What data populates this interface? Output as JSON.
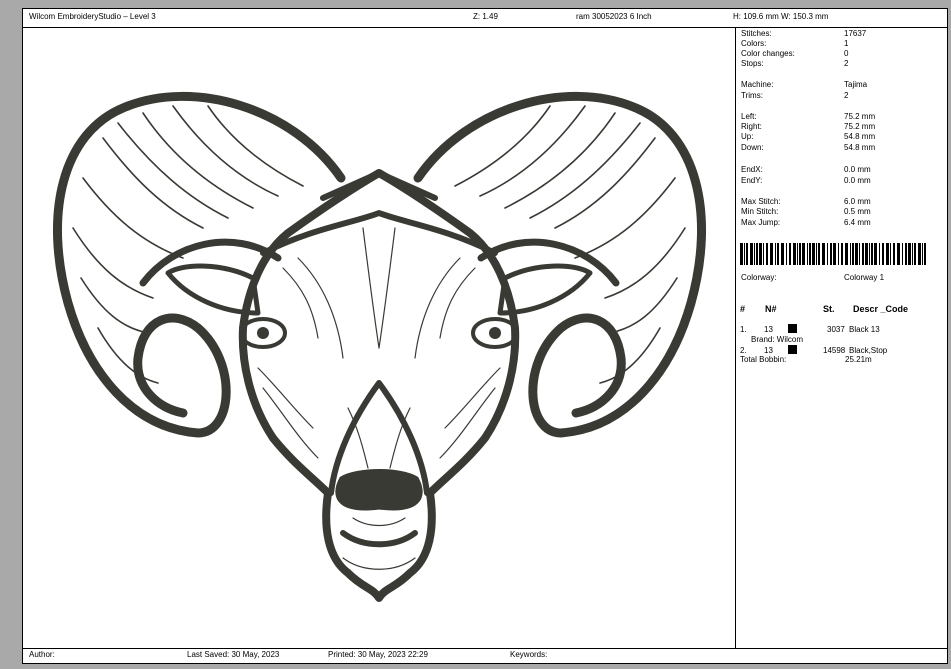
{
  "header": {
    "app": "Wilcom EmbroideryStudio – Level 3",
    "zoom": "Z: 1.49",
    "file": "ram 30052023 6  Inch",
    "size": "H: 109.6 mm   W: 150.3 mm"
  },
  "footer": {
    "author": "Author:",
    "saved": "Last Saved: 30 May, 2023",
    "printed": "Printed: 30 May, 2023 22:29",
    "keywords": "Keywords:"
  },
  "info": {
    "stats": [
      {
        "label": "Stitches:",
        "value": "17637"
      },
      {
        "label": "Colors:",
        "value": "1"
      },
      {
        "label": "Color changes:",
        "value": "0"
      },
      {
        "label": "Stops:",
        "value": "2"
      }
    ],
    "machine": [
      {
        "label": "Machine:",
        "value": "Tajima"
      },
      {
        "label": "Trims:",
        "value": "2"
      }
    ],
    "extents": [
      {
        "label": "Left:",
        "value": "75.2 mm"
      },
      {
        "label": "Right:",
        "value": "75.2 mm"
      },
      {
        "label": "Up:",
        "value": "54.8 mm"
      },
      {
        "label": "Down:",
        "value": "54.8 mm"
      }
    ],
    "end": [
      {
        "label": "EndX:",
        "value": "0.0 mm"
      },
      {
        "label": "EndY:",
        "value": "0.0 mm"
      }
    ],
    "stitch": [
      {
        "label": "Max Stitch:",
        "value": "6.0 mm"
      },
      {
        "label": "Min Stitch:",
        "value": "0.5 mm"
      },
      {
        "label": "Max Jump:",
        "value": "6.4 mm"
      }
    ],
    "colorway_label": "Colorway:",
    "colorway_value": "Colorway 1"
  },
  "table": {
    "headers": [
      "#",
      "N#",
      "St.",
      "Descr _Code"
    ],
    "rows": [
      {
        "idx": "1.",
        "n": "13",
        "st": "3037",
        "descr": "Black 13",
        "brand": "Brand: Wilcom"
      },
      {
        "idx": "2.",
        "n": "13",
        "st": "14598",
        "descr": "Black,Stop",
        "brand": ""
      }
    ],
    "total_label": "Total Bobbin:",
    "total_value": "25.21m"
  },
  "colors": {
    "thread": "#3a3a34",
    "paper": "#ffffff",
    "background": "#a9a9a9"
  }
}
